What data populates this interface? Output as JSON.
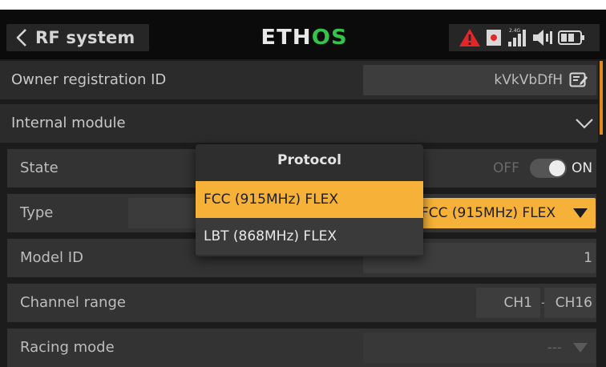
{
  "header": {
    "title": "RF system",
    "logo_part1": "ETH",
    "logo_part2": "OS",
    "status_icons": [
      "warning-icon",
      "rec-icon",
      "signal-bars-icon",
      "volume-icon",
      "battery-icon"
    ],
    "rssi_tiny": "2.4G"
  },
  "rows": {
    "owner_label": "Owner registration ID",
    "owner_value": "kVkVbDfH",
    "internal_label": "Internal module",
    "state_label": "State",
    "state_off": "OFF",
    "state_on": "ON",
    "type_label": "Type",
    "type_value": "FCC (915MHz) FLEX",
    "model_id_label": "Model ID",
    "model_id_value": "1",
    "channel_range_label": "Channel range",
    "channel_start": "CH1",
    "channel_sep": "-",
    "channel_end": "CH16",
    "racing_label": "Racing mode",
    "racing_value": "---"
  },
  "modal": {
    "title": "Protocol",
    "options": [
      "FCC (915MHz) FLEX",
      "LBT (868MHz) FLEX"
    ],
    "selected_index": 0
  },
  "colors": {
    "accent": "#f6b238",
    "logo_green": "#35c44a",
    "warning_red": "#e3262a",
    "scroll_orange": "#e2891c"
  }
}
